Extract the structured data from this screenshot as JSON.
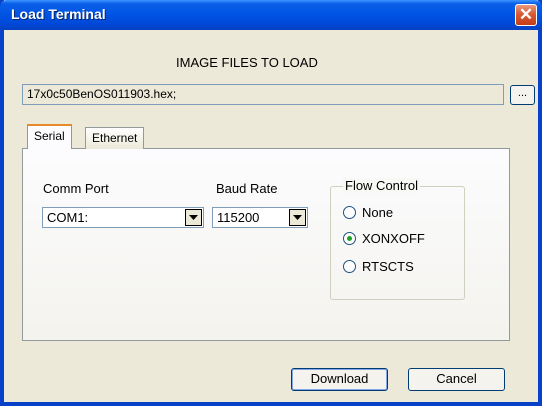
{
  "window": {
    "title": "Load Terminal",
    "close_glyph": "✕"
  },
  "files": {
    "heading": "IMAGE FILES TO LOAD",
    "value": "17x0c50BenOS011903.hex;",
    "browse_label": "..."
  },
  "tabs": [
    {
      "label": "Serial",
      "selected": true
    },
    {
      "label": "Ethernet",
      "selected": false
    }
  ],
  "serial": {
    "comm_port_label": "Comm Port",
    "comm_port_value": "COM1:",
    "baud_rate_label": "Baud Rate",
    "baud_rate_value": "115200",
    "flow_control": {
      "legend": "Flow Control",
      "options": [
        {
          "label": "None",
          "checked": false
        },
        {
          "label": "XONXOFF",
          "checked": true
        },
        {
          "label": "RTSCTS",
          "checked": false
        }
      ]
    }
  },
  "buttons": {
    "download": "Download",
    "cancel": "Cancel"
  },
  "colors": {
    "title_bar": "#0055e5",
    "close_button": "#d95a33",
    "dialog_face": "#ece9d8",
    "tab_highlight": "#e68b2c",
    "radio_dot": "#21a121"
  }
}
